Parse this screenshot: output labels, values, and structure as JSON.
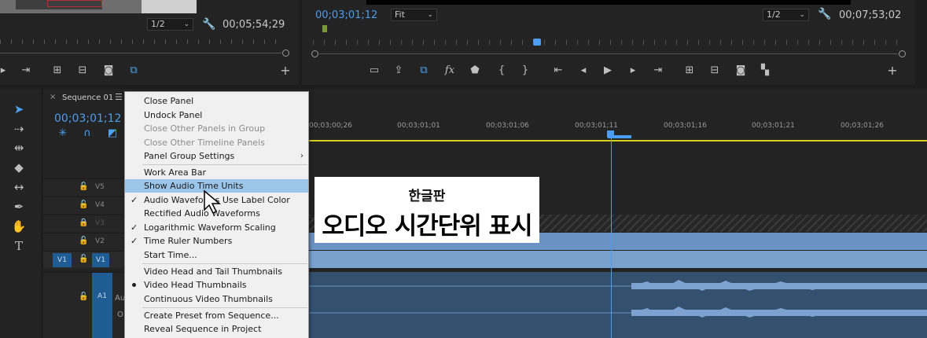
{
  "source_monitor": {
    "scale": "1/2",
    "timecode": "00;05;54;29",
    "wrench_icon": "wrench-icon"
  },
  "program_monitor": {
    "current_timecode": "00;03;01;12",
    "fit": "Fit",
    "scale": "1/2",
    "duration_timecode": "00;07;53;02"
  },
  "timeline": {
    "tab_close": "×",
    "sequence_name": "Sequence 01",
    "menu_glyph": "☰",
    "timecode": "00;03;01;12",
    "ruler_labels": [
      "00;03;00;26",
      "00;03;01;01",
      "00;03;01;06",
      "00;03;01;11",
      "00;03;01;16",
      "00;03;01;21",
      "00;03;01;26"
    ],
    "tracks": {
      "v5": "V5",
      "v4": "V4",
      "v3": "V3",
      "v2": "V2",
      "v1": "V1",
      "v1_source": "V1",
      "a1": "A1",
      "a1_partial": "Au",
      "a1_partial2": "O"
    }
  },
  "context_menu": {
    "items": [
      {
        "label": "Close Panel",
        "enabled": true
      },
      {
        "label": "Undock Panel",
        "enabled": true
      },
      {
        "label": "Close Other Panels in Group",
        "enabled": false
      },
      {
        "label": "Close Other Timeline Panels",
        "enabled": false
      },
      {
        "label": "Panel Group Settings",
        "enabled": true,
        "submenu": true
      },
      {
        "label": "Work Area Bar",
        "enabled": true
      },
      {
        "label": "Show Audio Time Units",
        "enabled": true,
        "highlighted": true
      },
      {
        "label": "Audio Waveforms Use Label Color",
        "enabled": true,
        "checked": true
      },
      {
        "label": "Rectified Audio Waveforms",
        "enabled": true
      },
      {
        "label": "Logarithmic Waveform Scaling",
        "enabled": true,
        "checked": true
      },
      {
        "label": "Time Ruler Numbers",
        "enabled": true,
        "checked": true
      },
      {
        "label": "Start Time...",
        "enabled": true
      },
      {
        "label": "Video Head and Tail Thumbnails",
        "enabled": true
      },
      {
        "label": "Video Head Thumbnails",
        "enabled": true,
        "radio": true
      },
      {
        "label": "Continuous Video Thumbnails",
        "enabled": true
      },
      {
        "label": "Create Preset from Sequence...",
        "enabled": true
      },
      {
        "label": "Reveal Sequence in Project",
        "enabled": true
      }
    ],
    "submenu_arrow": "›",
    "check_glyph": "✓"
  },
  "caption": {
    "small": "한글판",
    "big": "오디오 시간단위 표시"
  },
  "colors": {
    "accent": "#4a9df0",
    "clip_video": "#6a93c3",
    "clip_audio": "#3e5a7c",
    "work_area": "#d8d020",
    "menu_highlight": "#9cc5ea"
  }
}
